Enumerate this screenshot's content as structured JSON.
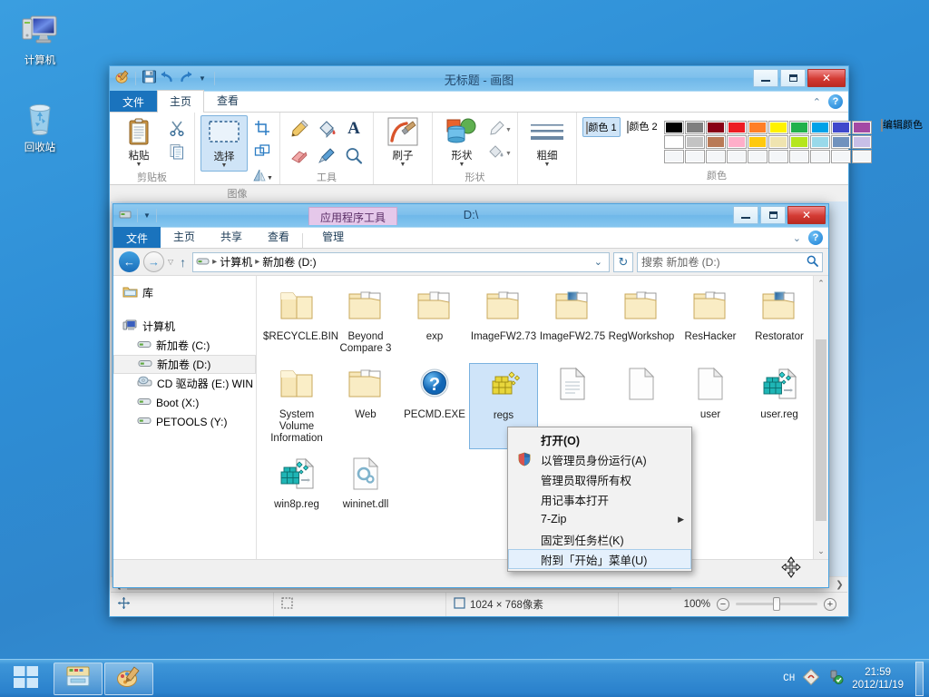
{
  "desktop": {
    "icons": [
      {
        "label": "计算机",
        "icon": "computer-icon"
      },
      {
        "label": "回收站",
        "icon": "recycle-bin-icon"
      }
    ]
  },
  "paint": {
    "title": "无标题 - 画图",
    "quick_access": [
      "paint-app-icon",
      "save-icon",
      "undo-icon",
      "redo-icon",
      "customize-qat-icon"
    ],
    "window_buttons": {
      "minimize": "—",
      "maximize": "❐",
      "close": "✕"
    },
    "tabs": [
      {
        "label": "文件",
        "kind": "file"
      },
      {
        "label": "主页",
        "kind": "active"
      },
      {
        "label": "查看",
        "kind": "normal"
      }
    ],
    "collapse_icon": "chevron-up-icon",
    "help_label": "?",
    "groups": [
      {
        "label": "剪贴板",
        "buttons": [
          {
            "label": "粘贴",
            "icon": "clipboard-icon",
            "dropdown": true
          },
          {
            "label": "",
            "icon": "cut-scissors-icon"
          },
          {
            "label": "",
            "icon": "copy-icon"
          }
        ]
      },
      {
        "label": "图像",
        "buttons": [
          {
            "label": "选择",
            "icon": "selection-rect-icon",
            "dropdown": true,
            "selected": true
          },
          {
            "label": "",
            "icon": "crop-icon"
          },
          {
            "label": "",
            "icon": "resize-icon"
          },
          {
            "label": "",
            "icon": "rotate-icon",
            "dropdown": true
          }
        ]
      },
      {
        "label": "工具",
        "buttons": [
          {
            "label": "",
            "icon": "pencil-icon"
          },
          {
            "label": "",
            "icon": "fill-bucket-icon"
          },
          {
            "label": "",
            "icon": "text-a-icon"
          },
          {
            "label": "",
            "icon": "eraser-icon"
          },
          {
            "label": "",
            "icon": "color-picker-icon"
          },
          {
            "label": "",
            "icon": "magnifier-icon"
          }
        ]
      },
      {
        "label": "",
        "buttons": [
          {
            "label": "刷子",
            "icon": "brush-icon",
            "dropdown": true
          }
        ]
      },
      {
        "label": "形状",
        "buttons": [
          {
            "label": "形状",
            "icon": "shapes-icon",
            "dropdown": true
          },
          {
            "label": "",
            "icon": "outline-pen-icon",
            "dropdown": true
          },
          {
            "label": "",
            "icon": "fill-style-icon",
            "dropdown": true
          }
        ]
      },
      {
        "label": "",
        "buttons": [
          {
            "label": "粗细",
            "icon": "line-thickness-icon",
            "dropdown": true
          }
        ]
      }
    ],
    "colors": {
      "group_label": "颜色",
      "color1_label": "颜色 1",
      "color1_value": "#000000",
      "color2_label": "颜色 2",
      "color2_value": "#ffffff",
      "edit_label": "编辑颜色",
      "edit_icon": "color-wheel-icon",
      "row1": [
        "#000000",
        "#7f7f7f",
        "#880015",
        "#ed1c24",
        "#ff7f27",
        "#fff200",
        "#22b14c",
        "#00a2e8",
        "#3f48cc",
        "#a349a4"
      ],
      "row2": [
        "#ffffff",
        "#c3c3c3",
        "#b97a57",
        "#ffaec9",
        "#ffc90e",
        "#efe4b0",
        "#b5e61d",
        "#99d9ea",
        "#7092be",
        "#c8bfe7"
      ],
      "row3": [
        "#f4f6f8",
        "#f4f6f8",
        "#f4f6f8",
        "#f4f6f8",
        "#f4f6f8",
        "#f4f6f8",
        "#f4f6f8",
        "#f4f6f8",
        "#f4f6f8",
        "#f4f6f8"
      ]
    },
    "statusbar": {
      "cursor_icon": "crosshair-icon",
      "selection_icon": "selection-size-icon",
      "size_icon": "canvas-size-icon",
      "size_text": "1024 × 768像素",
      "zoom_label": "100%",
      "zoom_out": "−",
      "zoom_in": "+"
    },
    "hscroll": {
      "left_arrow": "❮",
      "right_arrow": "❯"
    }
  },
  "explorer": {
    "title": "D:\\",
    "contextual_tab_header": "应用程序工具",
    "quick_access": [
      "folder-icon",
      "customize-qat-icon"
    ],
    "window_buttons": {
      "minimize": "—",
      "maximize": "❐",
      "close": "✕"
    },
    "tabs": [
      {
        "label": "文件",
        "kind": "file"
      },
      {
        "label": "主页",
        "kind": "normal"
      },
      {
        "label": "共享",
        "kind": "normal"
      },
      {
        "label": "查看",
        "kind": "normal"
      },
      {
        "label": "管理",
        "kind": "contextual"
      }
    ],
    "expand_icon": "chevron-down-icon",
    "help_label": "?",
    "nav": {
      "back_icon": "back-arrow-icon",
      "forward_icon": "forward-arrow-icon",
      "recent_icon": "recent-locations-icon",
      "up_icon": "up-arrow-icon",
      "breadcrumb": [
        "计算机",
        "新加卷 (D:)"
      ],
      "breadcrumb_drive_icon": "drive-icon",
      "dropdown_icon": "chevron-down-icon",
      "refresh_icon": "refresh-icon",
      "search_placeholder": "搜索 新加卷 (D:)",
      "search_icon": "search-icon"
    },
    "navpane": [
      {
        "label": "库",
        "icon": "library-icon",
        "indent": 0
      },
      {
        "label": "计算机",
        "icon": "computer-small-icon",
        "indent": 0,
        "gap_before": true
      },
      {
        "label": "新加卷 (C:)",
        "icon": "drive-icon",
        "indent": 1
      },
      {
        "label": "新加卷 (D:)",
        "icon": "drive-icon",
        "indent": 1,
        "selected": true
      },
      {
        "label": "CD 驱动器 (E:) WIN",
        "icon": "cd-drive-icon",
        "indent": 1
      },
      {
        "label": "Boot (X:)",
        "icon": "drive-icon",
        "indent": 1
      },
      {
        "label": "PETOOLS (Y:)",
        "icon": "drive-icon",
        "indent": 1
      }
    ],
    "files": [
      {
        "name": "$RECYCLE.BIN",
        "icon": "folder-plain-icon"
      },
      {
        "name": "Beyond Compare 3",
        "icon": "folder-docs-icon"
      },
      {
        "name": "exp",
        "icon": "folder-images-icon"
      },
      {
        "name": "ImageFW2.73",
        "icon": "folder-docs-icon"
      },
      {
        "name": "ImageFW2.75",
        "icon": "folder-blue-icon"
      },
      {
        "name": "RegWorkshop",
        "icon": "folder-docs-icon"
      },
      {
        "name": "ResHacker",
        "icon": "folder-docs-icon"
      },
      {
        "name": "Restorator",
        "icon": "folder-blue-icon"
      },
      {
        "name": "System Volume Information",
        "icon": "folder-plain-icon"
      },
      {
        "name": "Web",
        "icon": "folder-docs-icon"
      },
      {
        "name": "PECMD.EXE",
        "icon": "question-ball-icon"
      },
      {
        "name": "regs",
        "icon": "registry-yellow-icon",
        "selected": true
      },
      {
        "name": "",
        "icon": "text-file-icon"
      },
      {
        "name": "",
        "icon": "blank-file-icon"
      },
      {
        "name": "user",
        "icon": "blank-file-icon"
      },
      {
        "name": "user.reg",
        "icon": "registry-teal-icon"
      },
      {
        "name": "win8p.reg",
        "icon": "registry-teal-icon"
      },
      {
        "name": "wininet.dll",
        "icon": "dll-file-icon"
      }
    ],
    "scrollbar": {
      "up_arrow": "⌃",
      "down_arrow": "⌄"
    }
  },
  "context_menu": {
    "items": [
      {
        "label": "打开(O)",
        "bold": true
      },
      {
        "label": "以管理员身份运行(A)",
        "icon": "uac-shield-icon"
      },
      {
        "label": "管理员取得所有权"
      },
      {
        "label": "用记事本打开"
      },
      {
        "label": "7-Zip",
        "submenu": true,
        "arrow": "▶"
      },
      {
        "label": "固定到任务栏(K)"
      },
      {
        "label": "附到「开始」菜单(U)",
        "highlighted": true
      }
    ]
  },
  "taskbar": {
    "start_icon": "windows-logo-icon",
    "buttons": [
      {
        "icon": "file-explorer-icon",
        "name": "explorer"
      },
      {
        "icon": "paint-app-icon",
        "name": "paint"
      }
    ],
    "tray": {
      "ime": "CH",
      "ime_icon": "ime-icon",
      "usb_icon": "safely-remove-icon",
      "time": "21:59",
      "date": "2012/11/19"
    }
  }
}
